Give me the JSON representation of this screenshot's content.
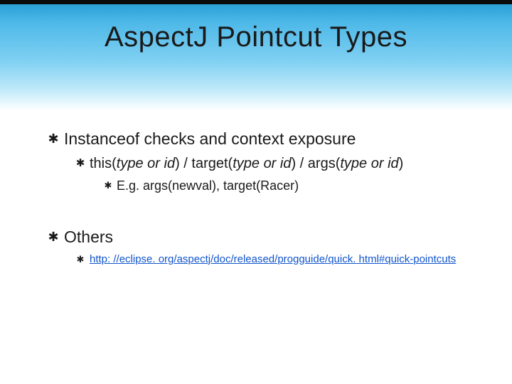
{
  "title": "AspectJ Pointcut Types",
  "section1": {
    "heading": "Instanceof checks and context exposure",
    "sub_prefix": "this(",
    "sub_arg1": "type or id",
    "sub_mid1": ") / target(",
    "sub_arg2": "type or id",
    "sub_mid2": ") / args(",
    "sub_arg3": "type or id",
    "sub_suffix": ")",
    "example": "E.g. args(newval), target(Racer)"
  },
  "section2": {
    "heading": "Others",
    "link_text": "http: //eclipse. org/aspectj/doc/released/progguide/quick. html#quick-pointcuts"
  },
  "bullet_glyph": "✱"
}
